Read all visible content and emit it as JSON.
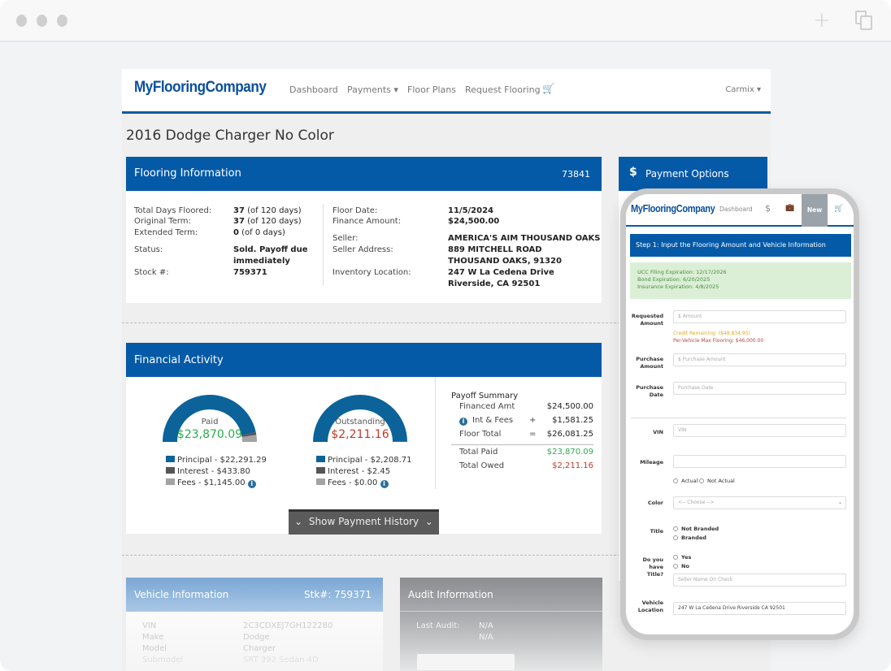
{
  "browser": {
    "new_tab_icon": "+",
    "tabs_icon": "copy-icon"
  },
  "nav": {
    "logo": "MyFlooringCompany",
    "links": [
      "Dashboard",
      "Payments ▾",
      "Floor Plans",
      "Request Flooring"
    ],
    "cart_icon": "🛒",
    "user": "Carmix ▾"
  },
  "page_title": "2016 Dodge Charger No Color",
  "flooring_info": {
    "title": "Flooring Information",
    "number": "73841",
    "left": [
      {
        "label": "Total Days Floored:",
        "value_bold": "37",
        "value_rest": " (of 120 days)"
      },
      {
        "label": "Original Term:",
        "value_bold": "37",
        "value_rest": " (of 120 days)"
      },
      {
        "label": "Extended Term:",
        "value_bold": "0",
        "value_rest": " (of 0 days)"
      },
      {
        "label": "Status:",
        "value_bold": "Sold. Payoff due",
        "value_rest": ""
      },
      {
        "label": "",
        "value_bold": "immediately",
        "value_rest": ""
      },
      {
        "label": "Stock #:",
        "value_bold": "759371",
        "value_rest": ""
      }
    ],
    "right": [
      {
        "label": "Floor Date:",
        "value": "11/5/2024"
      },
      {
        "label": "Finance Amount:",
        "value": "$24,500.00"
      },
      {
        "label": "Seller:",
        "value": "AMERICA'S AIM THOUSAND OAKS"
      },
      {
        "label": "Seller Address:",
        "value": "889 MITCHELL ROAD"
      },
      {
        "label": "",
        "value": "THOUSAND OAKS, 91320"
      },
      {
        "label": "Inventory Location:",
        "value": "247 W La Cedena Drive"
      },
      {
        "label": "",
        "value": "Riverside, CA 92501"
      }
    ]
  },
  "financial_activity": {
    "title": "Financial Activity",
    "paid": {
      "label": "Paid",
      "amount": "$23,870.09",
      "principal": 22291.29,
      "interest": 433.8,
      "fees": 1145.0,
      "legend": [
        "Principal - $22,291.29",
        "Interest - $433.80",
        "Fees - $1,145.00"
      ]
    },
    "outstanding": {
      "label": "Outstanding",
      "amount": "$2,211.16",
      "principal": 2208.71,
      "interest": 2.45,
      "fees": 0.0,
      "legend": [
        "Principal - $2,208.71",
        "Interest - $2.45",
        "Fees - $0.00"
      ]
    },
    "colors": {
      "principal": "#0b6399",
      "interest": "#555555",
      "fees": "#a3a3a3",
      "paid": "#2eaa4f",
      "owed": "#c0392b"
    },
    "payoff": {
      "title": "Payoff Summary",
      "rows": [
        {
          "label": "Financed Amt",
          "op": "",
          "value": "$24,500.00"
        },
        {
          "label": "Int & Fees",
          "op": "+",
          "value": "$1,581.25"
        },
        {
          "label": "Floor Total",
          "op": "=",
          "value": "$26,081.25"
        }
      ],
      "total_paid_label": "Total Paid",
      "total_paid": "$23,870.09",
      "total_owed_label": "Total Owed",
      "total_owed": "$2,211.16"
    },
    "history_button": "Show Payment History"
  },
  "vehicle_info": {
    "title": "Vehicle Information",
    "stock": "Stk#: 759371",
    "rows": [
      {
        "label": "VIN",
        "value": "2C3CDXEJ7GH122280"
      },
      {
        "label": "Make",
        "value": "Dodge"
      },
      {
        "label": "Model",
        "value": "Charger"
      },
      {
        "label": "Submodel",
        "value": "SRT 392 Sedan 4D"
      }
    ]
  },
  "audit_info": {
    "title": "Audit Information",
    "last_audit_label": "Last Audit:",
    "values": [
      "N/A",
      "N/A"
    ]
  },
  "payment_options": {
    "icon": "$",
    "title": "Payment Options"
  },
  "mobile": {
    "logo": "MyFlooringCompany",
    "nav": {
      "dashboard": "Dashboard",
      "dollar": "$",
      "new": "New"
    },
    "step_title": "Step 1: Input the Flooring Amount and Vehicle Information",
    "alerts": [
      "UCC Filing Expiration: 12/17/2026",
      "Bond Expiration: 6/20/2025",
      "Insurance Expiration: 4/8/2025"
    ],
    "fields": {
      "requested_amount": {
        "label": "Requested Amount",
        "placeholder": "$ Amount"
      },
      "credit_remaining": "Credit Remaining: ($48,834.95)",
      "per_vehicle_max": "Per-Vehicle Max Flooring: $46,000.00",
      "purchase_amount": {
        "label": "Purchase Amount",
        "placeholder": "$ Purchase Amount"
      },
      "purchase_date": {
        "label": "Purchase Date",
        "placeholder": "Purchase Date"
      },
      "vin": {
        "label": "VIN",
        "placeholder": "VIN"
      },
      "mileage": {
        "label": "Mileage",
        "value": ""
      },
      "mileage_options": [
        "Actual",
        "Not Actual"
      ],
      "color": {
        "label": "Color",
        "selected": "<-- Choose -->"
      },
      "title": {
        "label": "Title",
        "options": [
          "Not Branded",
          "Branded"
        ]
      },
      "have_title": {
        "label": "Do you have Title?",
        "options": [
          "Yes",
          "No"
        ],
        "placeholder": "Seller Name On Check"
      },
      "vehicle_location": {
        "label": "Vehicle Location",
        "value": "247 W La Cedena Drive Riverside CA 92501"
      }
    }
  }
}
